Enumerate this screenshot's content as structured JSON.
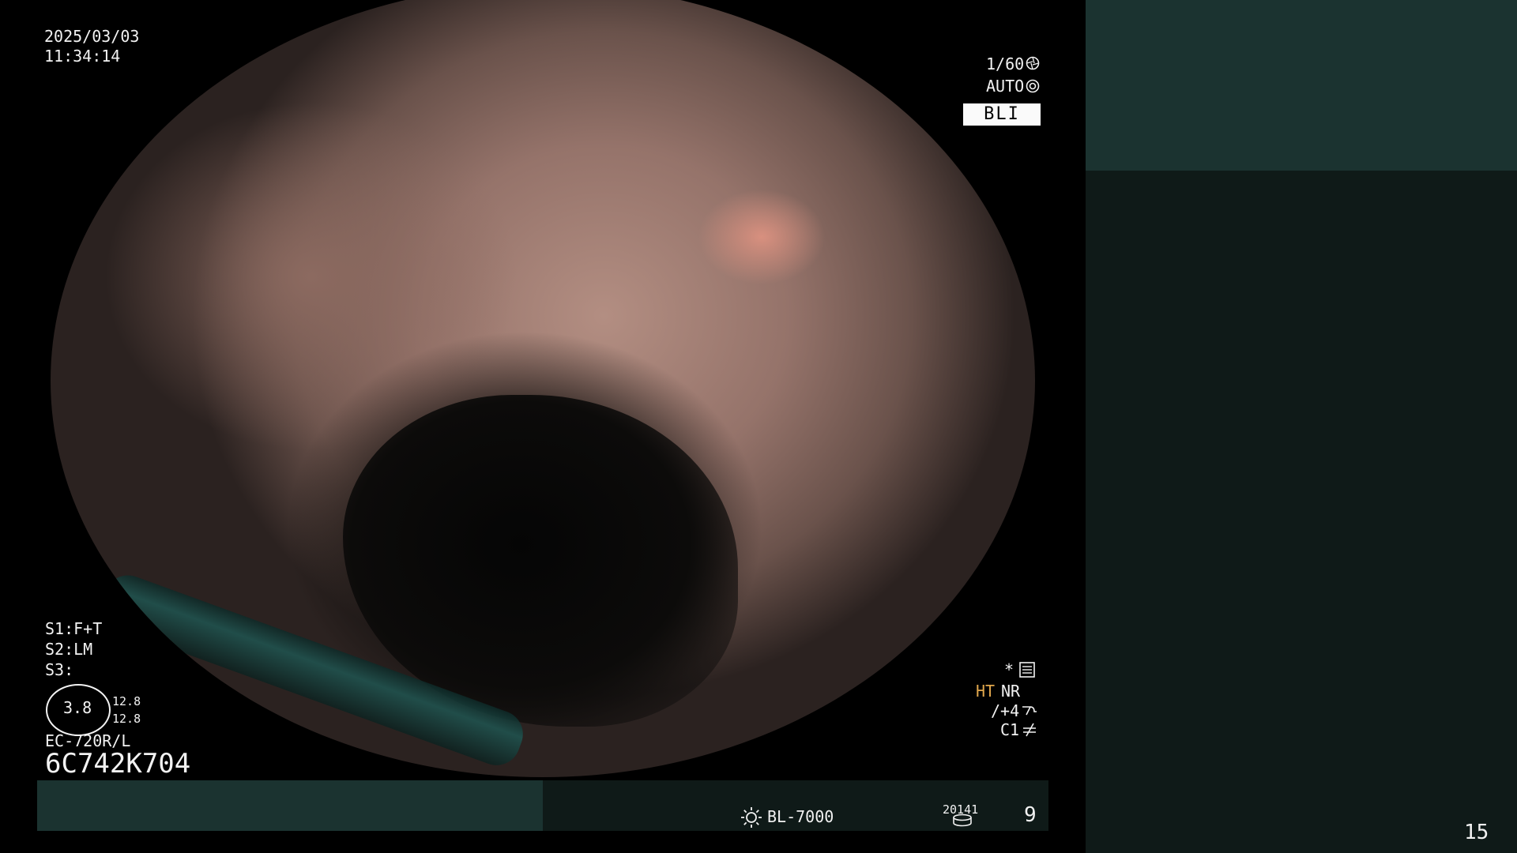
{
  "overlay": {
    "date": "2025/03/03",
    "time": "11:34:14",
    "shutter": "1/60",
    "exposure_mode": "AUTO",
    "mode_badge": "BLI",
    "s1": "S1:F+T",
    "s2": "S2:LM",
    "s3": "S3:",
    "zoom": "3.8",
    "zoom_aux_top": "12.8",
    "zoom_aux_bottom": "12.8",
    "scope_model": "EC-720R/L",
    "scope_serial": "6C742K704",
    "star_label": "*",
    "ht_label": "HT",
    "nr_label": "NR",
    "enhance": "/+4",
    "color_mode": "C1",
    "light_source": "BL-7000",
    "storage_count": "20141",
    "storage_index": "9",
    "page_number": "15"
  },
  "colors": {
    "ht_accent": "#e0a64c",
    "panel_teal": "#1b3330",
    "panel_dark": "#0f1a18"
  },
  "icons": [
    "shutter-icon",
    "auto-exposure-icon",
    "settings-list-icon",
    "structure-enhance-icon",
    "color-mode-icon",
    "lamp-icon",
    "disk-icon"
  ]
}
